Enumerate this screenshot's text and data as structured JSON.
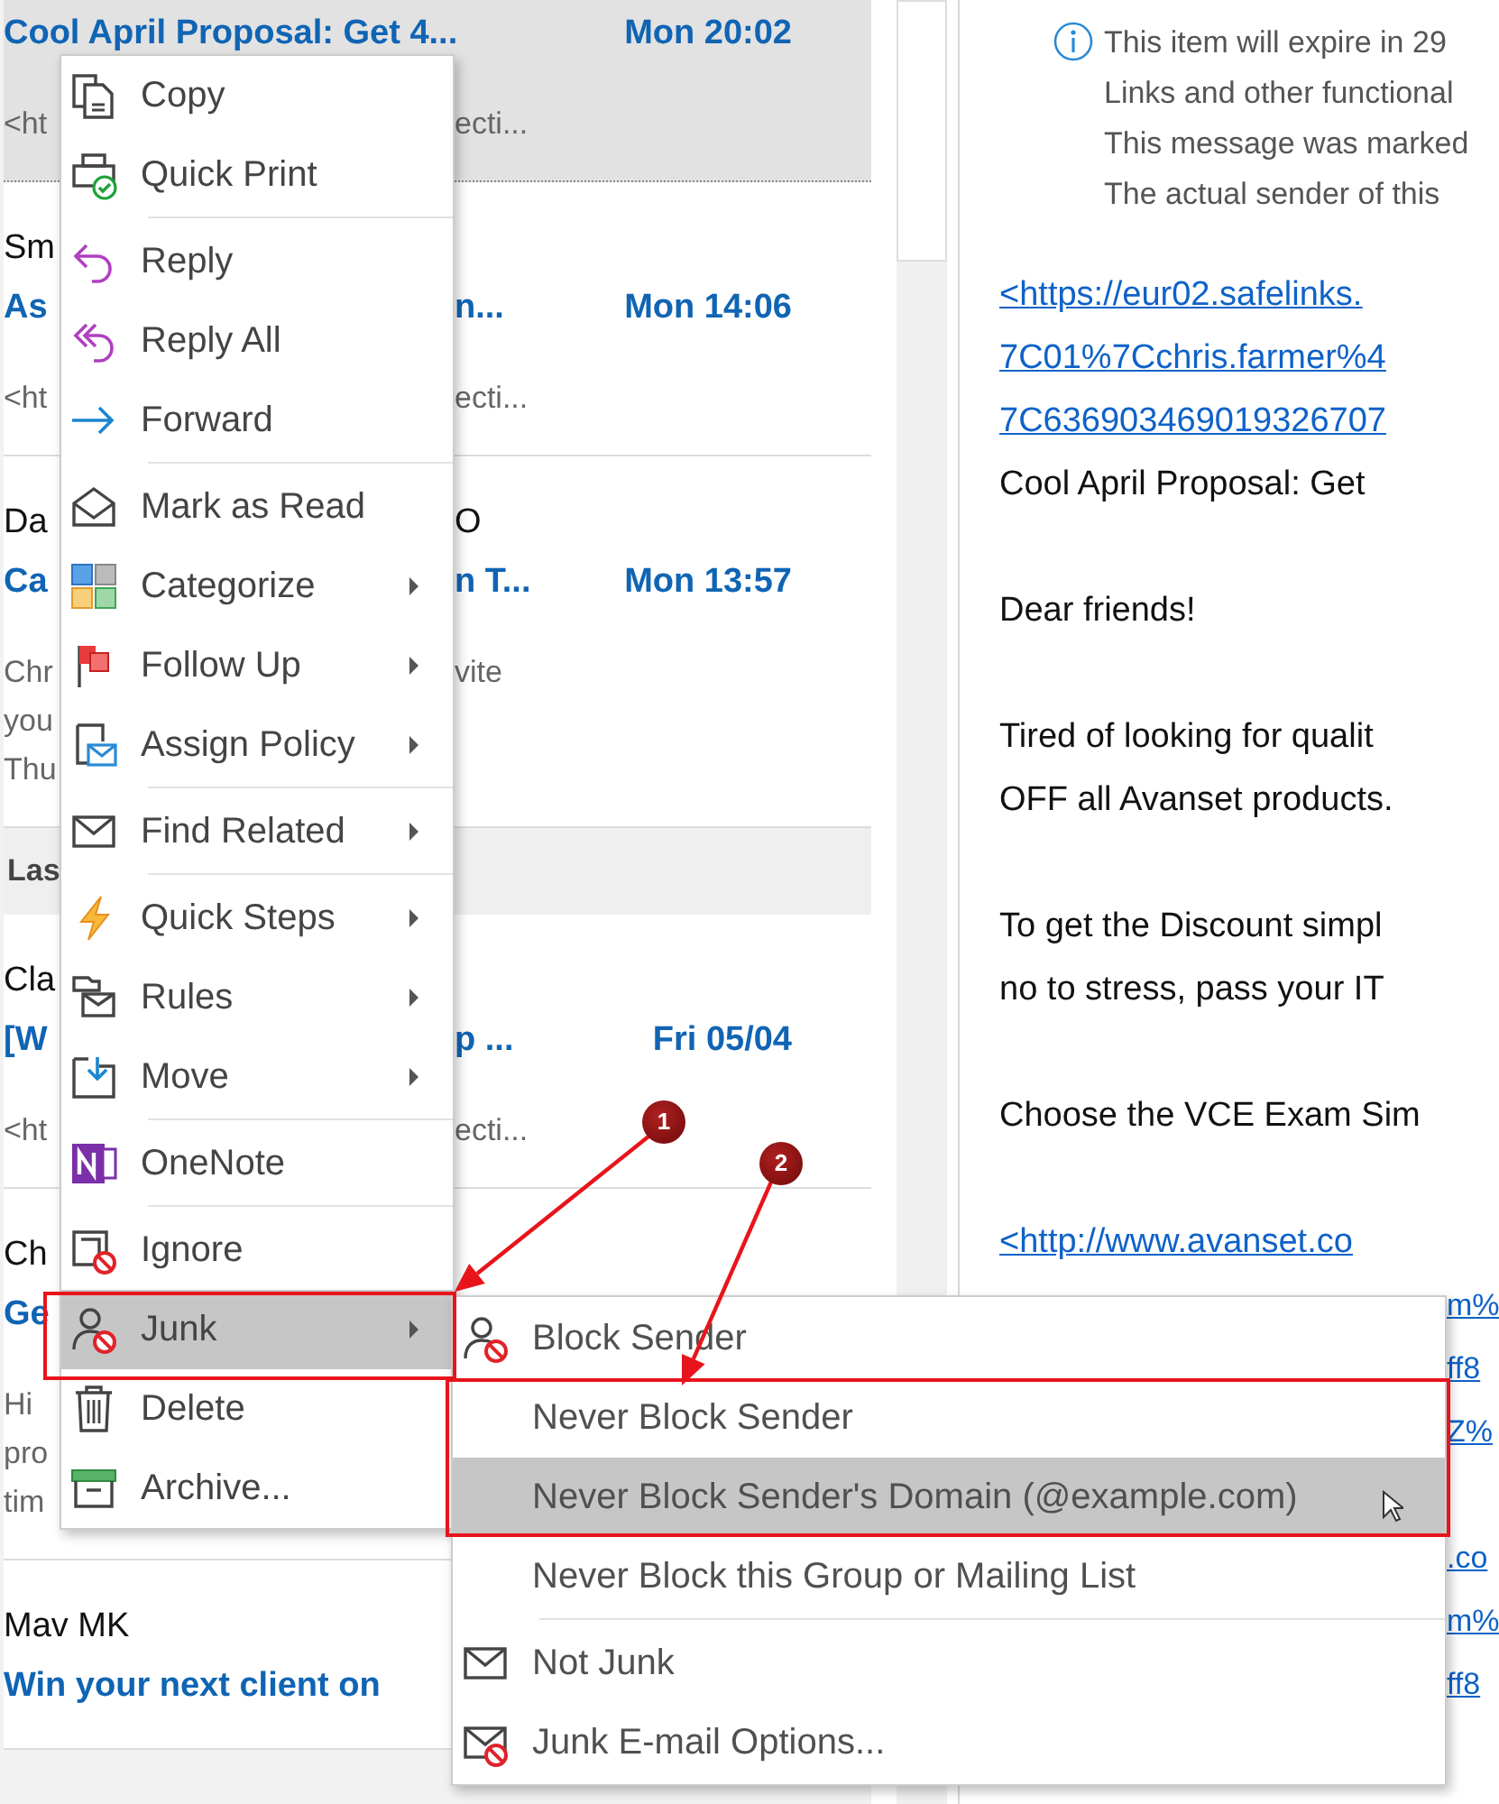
{
  "mail_list": [
    {
      "kind": "mail",
      "selected": true,
      "lines": [
        {
          "kind": "subject",
          "left": "Cool April Proposal: Get 4...",
          "time": "Mon 20:02"
        },
        {
          "kind": "preview",
          "left": "<ht",
          "right": "ecti..."
        }
      ]
    },
    {
      "kind": "mail",
      "selected": false,
      "lines": [
        {
          "kind": "sender",
          "left": "Sm"
        },
        {
          "kind": "subject",
          "left": "As",
          "right": "n...",
          "time": "Mon 14:06"
        },
        {
          "kind": "preview",
          "left": "<ht",
          "right": "ecti..."
        }
      ]
    },
    {
      "kind": "mail",
      "selected": false,
      "lines": [
        {
          "kind": "sender",
          "left": "Da",
          "right": "O"
        },
        {
          "kind": "subject",
          "left": "Ca",
          "right": "n T...",
          "time": "Mon 13:57"
        },
        {
          "kind": "preview",
          "left": "Chr",
          "right": "vite"
        },
        {
          "kind": "preview",
          "left": "you"
        },
        {
          "kind": "preview",
          "left": "Thu"
        }
      ]
    },
    {
      "kind": "group_header",
      "label": "Las"
    },
    {
      "kind": "mail",
      "selected": false,
      "lines": [
        {
          "kind": "sender",
          "left": "Cla"
        },
        {
          "kind": "subject",
          "left": "[W",
          "right": "p ...",
          "time": "Fri 05/04"
        },
        {
          "kind": "preview",
          "left": "<ht",
          "right": "ecti..."
        }
      ]
    },
    {
      "kind": "mail",
      "selected": false,
      "lines": [
        {
          "kind": "sender",
          "left": "Ch"
        },
        {
          "kind": "subject",
          "left": "Ge"
        },
        {
          "kind": "preview",
          "left": "Hi"
        },
        {
          "kind": "preview",
          "left": "pro"
        },
        {
          "kind": "preview",
          "left": "tim"
        }
      ]
    },
    {
      "kind": "mail",
      "selected": false,
      "lines": [
        {
          "kind": "sender",
          "left": "Mav MK"
        },
        {
          "kind": "subject",
          "left": "Win your next client on"
        }
      ]
    }
  ],
  "reading_pane": {
    "info_lines": [
      "This item will expire in 29",
      "Links and other functional",
      "This message was marked",
      "The actual sender of this"
    ],
    "body": [
      {
        "kind": "link",
        "prefix": "<",
        "text": "https://eur02.safelinks."
      },
      {
        "kind": "link",
        "text": "7C01%7Cchris.farmer%4"
      },
      {
        "kind": "link",
        "text": "7C636903469019326707"
      },
      {
        "kind": "text",
        "text": "Cool April Proposal: Get"
      },
      {
        "kind": "blank"
      },
      {
        "kind": "text",
        "text": "Dear friends!"
      },
      {
        "kind": "blank"
      },
      {
        "kind": "text",
        "text": "Tired of looking for qualit"
      },
      {
        "kind": "text",
        "text": "OFF all Avanset products."
      },
      {
        "kind": "blank"
      },
      {
        "kind": "text",
        "text": "To get the Discount simpl"
      },
      {
        "kind": "text",
        "text": "no to stress, pass your IT"
      },
      {
        "kind": "blank"
      },
      {
        "kind": "text",
        "text": "Choose the VCE Exam Sim"
      },
      {
        "kind": "blank"
      },
      {
        "kind": "link",
        "prefix": "<",
        "text": "http://www.avanset.co"
      },
      {
        "kind": "tail",
        "text": "m%"
      },
      {
        "kind": "tail",
        "text": "ff8"
      },
      {
        "kind": "tail",
        "text": "Z%"
      },
      {
        "kind": "blank"
      },
      {
        "kind": "tail",
        "text": ".co"
      },
      {
        "kind": "tail",
        "text": "m%"
      },
      {
        "kind": "tail",
        "text": "ff8"
      }
    ]
  },
  "context_menu": [
    {
      "label": "Copy",
      "separator_before": false,
      "submenu": false,
      "highlighted": false
    },
    {
      "label": "Quick Print",
      "separator_before": false,
      "submenu": false,
      "highlighted": false
    },
    {
      "label": "Reply",
      "separator_before": true,
      "submenu": false,
      "highlighted": false
    },
    {
      "label": "Reply All",
      "separator_before": false,
      "submenu": false,
      "highlighted": false
    },
    {
      "label": "Forward",
      "separator_before": false,
      "submenu": false,
      "highlighted": false
    },
    {
      "label": "Mark as Read",
      "separator_before": true,
      "submenu": false,
      "highlighted": false
    },
    {
      "label": "Categorize",
      "separator_before": false,
      "submenu": true,
      "highlighted": false
    },
    {
      "label": "Follow Up",
      "separator_before": false,
      "submenu": true,
      "highlighted": false
    },
    {
      "label": "Assign Policy",
      "separator_before": false,
      "submenu": true,
      "highlighted": false
    },
    {
      "label": "Find Related",
      "separator_before": true,
      "submenu": true,
      "highlighted": false
    },
    {
      "label": "Quick Steps",
      "separator_before": true,
      "submenu": true,
      "highlighted": false
    },
    {
      "label": "Rules",
      "separator_before": false,
      "submenu": true,
      "highlighted": false
    },
    {
      "label": "Move",
      "separator_before": false,
      "submenu": true,
      "highlighted": false
    },
    {
      "label": "OneNote",
      "separator_before": true,
      "submenu": false,
      "highlighted": false
    },
    {
      "label": "Ignore",
      "separator_before": true,
      "submenu": false,
      "highlighted": false
    },
    {
      "label": "Junk",
      "separator_before": false,
      "submenu": true,
      "highlighted": true
    },
    {
      "label": "Delete",
      "separator_before": false,
      "submenu": false,
      "highlighted": false
    },
    {
      "label": "Archive...",
      "separator_before": false,
      "submenu": false,
      "highlighted": false
    }
  ],
  "junk_submenu": [
    {
      "label": "Block Sender",
      "separator_before": false,
      "highlighted": false
    },
    {
      "label": "Never Block Sender",
      "separator_before": false,
      "highlighted": false
    },
    {
      "label": "Never Block Sender's Domain (@example.com)",
      "separator_before": false,
      "highlighted": true
    },
    {
      "label": "Never Block this Group or Mailing List",
      "separator_before": false,
      "highlighted": false
    },
    {
      "label": "Not Junk",
      "separator_before": true,
      "highlighted": false
    },
    {
      "label": "Junk E-mail Options...",
      "separator_before": false,
      "highlighted": false
    }
  ],
  "annotations": [
    {
      "label": "1"
    },
    {
      "label": "2"
    }
  ]
}
